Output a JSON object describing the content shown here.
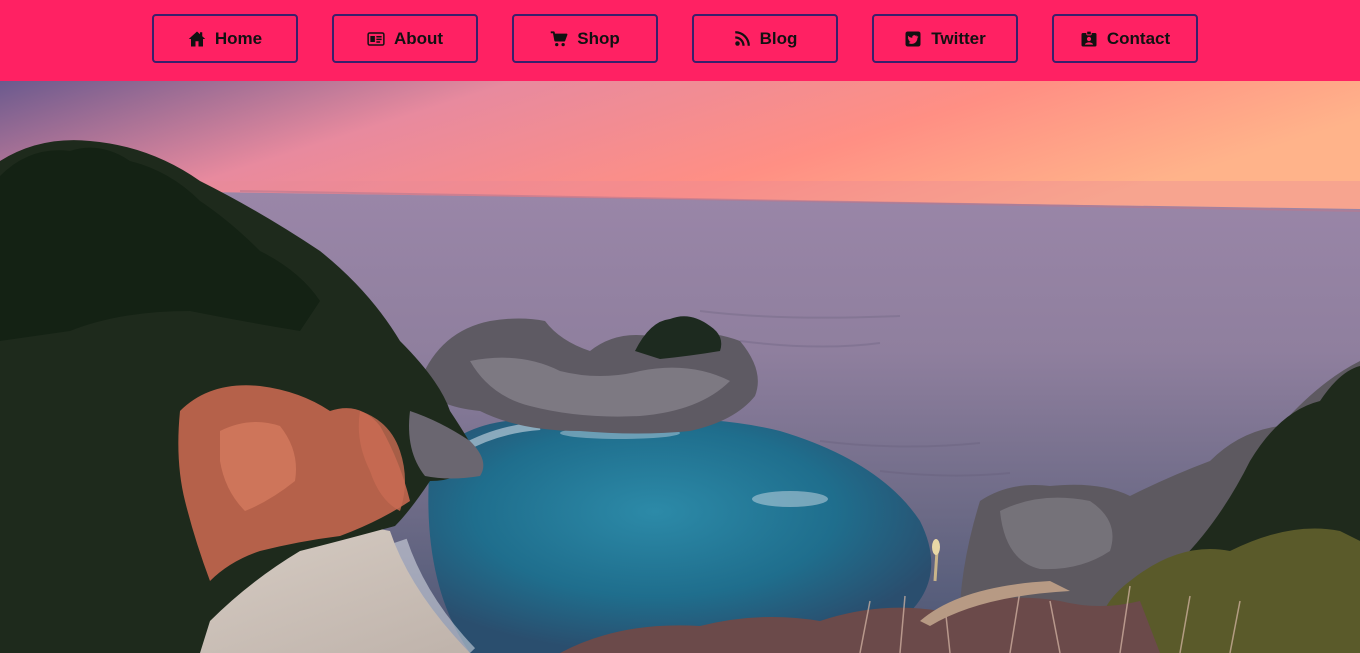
{
  "nav": {
    "items": [
      {
        "label": "Home",
        "icon": "home-icon"
      },
      {
        "label": "About",
        "icon": "id-card-icon"
      },
      {
        "label": "Shop",
        "icon": "shopping-cart-icon"
      },
      {
        "label": "Blog",
        "icon": "rss-icon"
      },
      {
        "label": "Twitter",
        "icon": "twitter-icon"
      },
      {
        "label": "Contact",
        "icon": "contact-badge-icon"
      }
    ]
  },
  "colors": {
    "nav_background": "#ff2163",
    "button_border": "#3a1f6b",
    "button_text": "#111111"
  },
  "hero": {
    "icon": "coastal-sunset-landscape-image"
  }
}
